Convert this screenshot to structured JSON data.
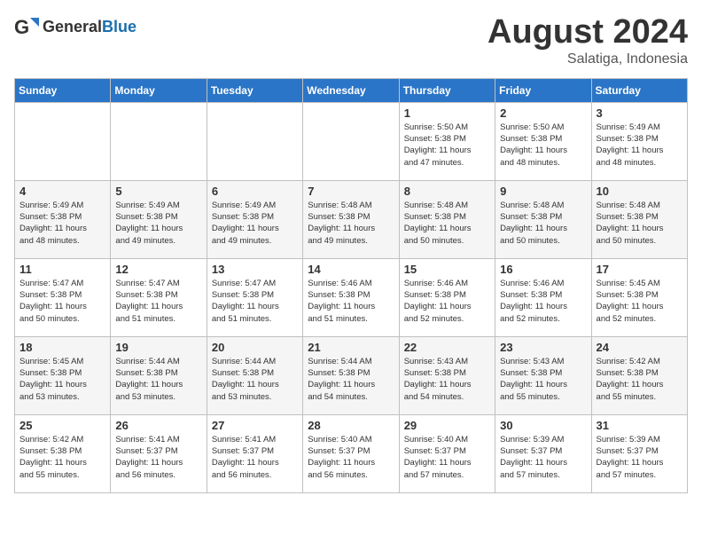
{
  "header": {
    "logo_general": "General",
    "logo_blue": "Blue",
    "month_year": "August 2024",
    "location": "Salatiga, Indonesia"
  },
  "days_of_week": [
    "Sunday",
    "Monday",
    "Tuesday",
    "Wednesday",
    "Thursday",
    "Friday",
    "Saturday"
  ],
  "weeks": [
    [
      {
        "day": "",
        "info": ""
      },
      {
        "day": "",
        "info": ""
      },
      {
        "day": "",
        "info": ""
      },
      {
        "day": "",
        "info": ""
      },
      {
        "day": "1",
        "info": "Sunrise: 5:50 AM\nSunset: 5:38 PM\nDaylight: 11 hours\nand 47 minutes."
      },
      {
        "day": "2",
        "info": "Sunrise: 5:50 AM\nSunset: 5:38 PM\nDaylight: 11 hours\nand 48 minutes."
      },
      {
        "day": "3",
        "info": "Sunrise: 5:49 AM\nSunset: 5:38 PM\nDaylight: 11 hours\nand 48 minutes."
      }
    ],
    [
      {
        "day": "4",
        "info": "Sunrise: 5:49 AM\nSunset: 5:38 PM\nDaylight: 11 hours\nand 48 minutes."
      },
      {
        "day": "5",
        "info": "Sunrise: 5:49 AM\nSunset: 5:38 PM\nDaylight: 11 hours\nand 49 minutes."
      },
      {
        "day": "6",
        "info": "Sunrise: 5:49 AM\nSunset: 5:38 PM\nDaylight: 11 hours\nand 49 minutes."
      },
      {
        "day": "7",
        "info": "Sunrise: 5:48 AM\nSunset: 5:38 PM\nDaylight: 11 hours\nand 49 minutes."
      },
      {
        "day": "8",
        "info": "Sunrise: 5:48 AM\nSunset: 5:38 PM\nDaylight: 11 hours\nand 50 minutes."
      },
      {
        "day": "9",
        "info": "Sunrise: 5:48 AM\nSunset: 5:38 PM\nDaylight: 11 hours\nand 50 minutes."
      },
      {
        "day": "10",
        "info": "Sunrise: 5:48 AM\nSunset: 5:38 PM\nDaylight: 11 hours\nand 50 minutes."
      }
    ],
    [
      {
        "day": "11",
        "info": "Sunrise: 5:47 AM\nSunset: 5:38 PM\nDaylight: 11 hours\nand 50 minutes."
      },
      {
        "day": "12",
        "info": "Sunrise: 5:47 AM\nSunset: 5:38 PM\nDaylight: 11 hours\nand 51 minutes."
      },
      {
        "day": "13",
        "info": "Sunrise: 5:47 AM\nSunset: 5:38 PM\nDaylight: 11 hours\nand 51 minutes."
      },
      {
        "day": "14",
        "info": "Sunrise: 5:46 AM\nSunset: 5:38 PM\nDaylight: 11 hours\nand 51 minutes."
      },
      {
        "day": "15",
        "info": "Sunrise: 5:46 AM\nSunset: 5:38 PM\nDaylight: 11 hours\nand 52 minutes."
      },
      {
        "day": "16",
        "info": "Sunrise: 5:46 AM\nSunset: 5:38 PM\nDaylight: 11 hours\nand 52 minutes."
      },
      {
        "day": "17",
        "info": "Sunrise: 5:45 AM\nSunset: 5:38 PM\nDaylight: 11 hours\nand 52 minutes."
      }
    ],
    [
      {
        "day": "18",
        "info": "Sunrise: 5:45 AM\nSunset: 5:38 PM\nDaylight: 11 hours\nand 53 minutes."
      },
      {
        "day": "19",
        "info": "Sunrise: 5:44 AM\nSunset: 5:38 PM\nDaylight: 11 hours\nand 53 minutes."
      },
      {
        "day": "20",
        "info": "Sunrise: 5:44 AM\nSunset: 5:38 PM\nDaylight: 11 hours\nand 53 minutes."
      },
      {
        "day": "21",
        "info": "Sunrise: 5:44 AM\nSunset: 5:38 PM\nDaylight: 11 hours\nand 54 minutes."
      },
      {
        "day": "22",
        "info": "Sunrise: 5:43 AM\nSunset: 5:38 PM\nDaylight: 11 hours\nand 54 minutes."
      },
      {
        "day": "23",
        "info": "Sunrise: 5:43 AM\nSunset: 5:38 PM\nDaylight: 11 hours\nand 55 minutes."
      },
      {
        "day": "24",
        "info": "Sunrise: 5:42 AM\nSunset: 5:38 PM\nDaylight: 11 hours\nand 55 minutes."
      }
    ],
    [
      {
        "day": "25",
        "info": "Sunrise: 5:42 AM\nSunset: 5:38 PM\nDaylight: 11 hours\nand 55 minutes."
      },
      {
        "day": "26",
        "info": "Sunrise: 5:41 AM\nSunset: 5:37 PM\nDaylight: 11 hours\nand 56 minutes."
      },
      {
        "day": "27",
        "info": "Sunrise: 5:41 AM\nSunset: 5:37 PM\nDaylight: 11 hours\nand 56 minutes."
      },
      {
        "day": "28",
        "info": "Sunrise: 5:40 AM\nSunset: 5:37 PM\nDaylight: 11 hours\nand 56 minutes."
      },
      {
        "day": "29",
        "info": "Sunrise: 5:40 AM\nSunset: 5:37 PM\nDaylight: 11 hours\nand 57 minutes."
      },
      {
        "day": "30",
        "info": "Sunrise: 5:39 AM\nSunset: 5:37 PM\nDaylight: 11 hours\nand 57 minutes."
      },
      {
        "day": "31",
        "info": "Sunrise: 5:39 AM\nSunset: 5:37 PM\nDaylight: 11 hours\nand 57 minutes."
      }
    ]
  ]
}
